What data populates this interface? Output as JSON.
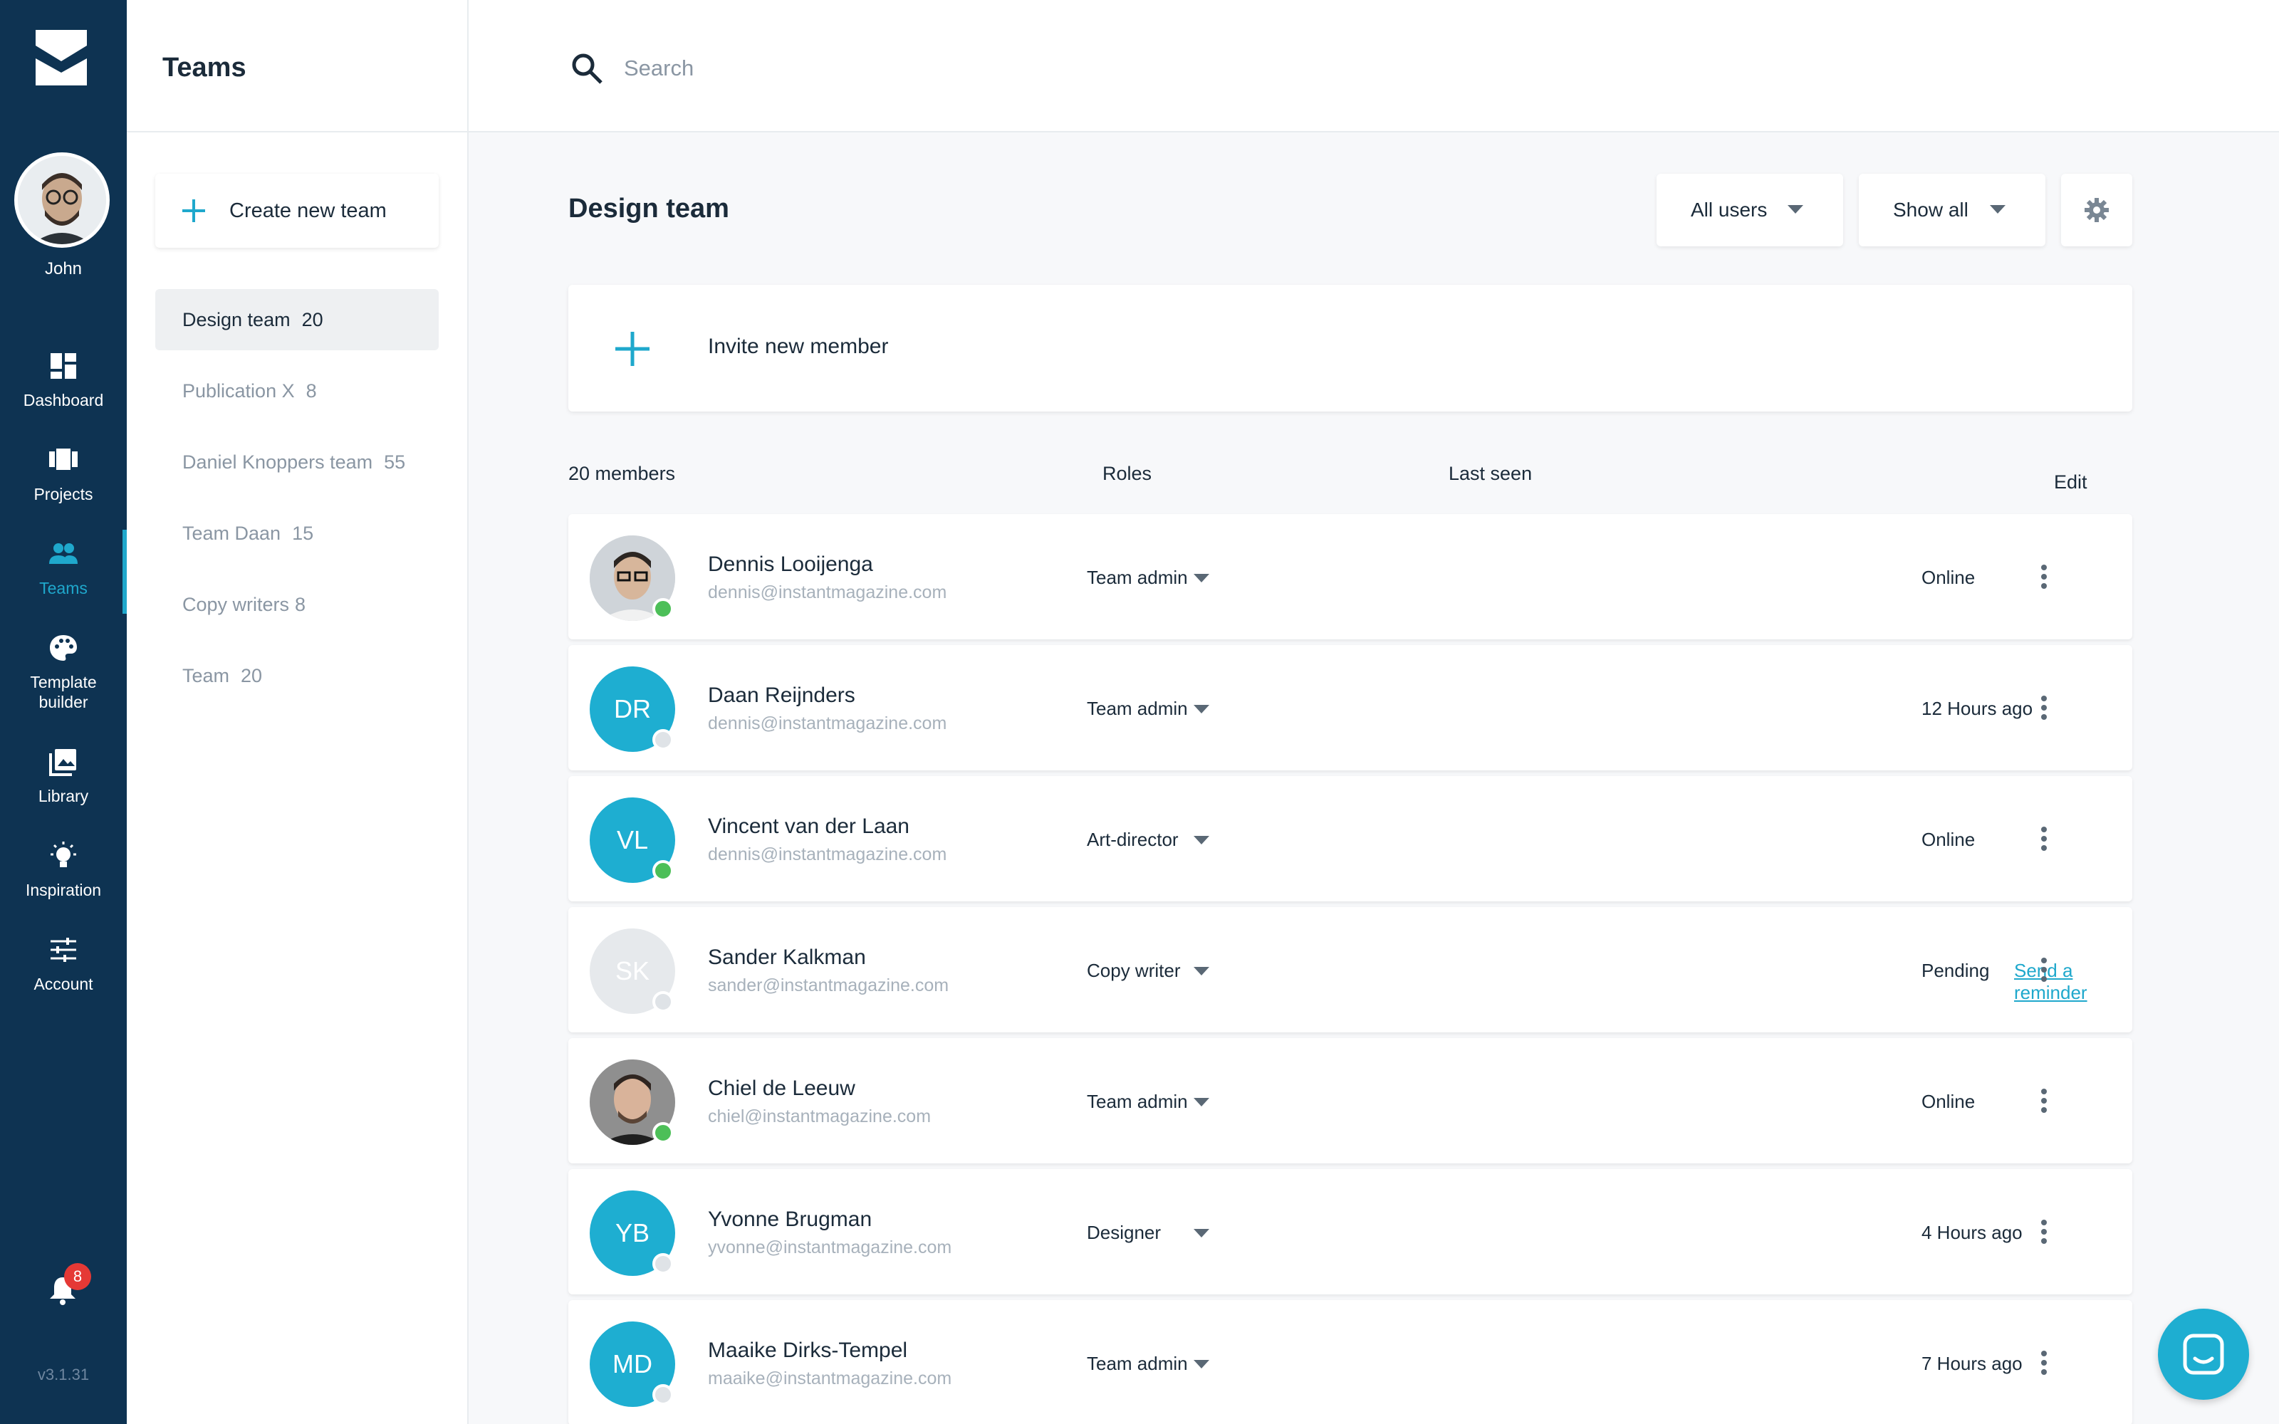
{
  "nav": {
    "username": "John",
    "items": [
      {
        "label": "Dashboard",
        "icon": "dashboard-icon"
      },
      {
        "label": "Projects",
        "icon": "projects-icon"
      },
      {
        "label": "Teams",
        "icon": "teams-icon",
        "active": true
      },
      {
        "label": "Template builder",
        "icon": "palette-icon"
      },
      {
        "label": "Library",
        "icon": "library-icon"
      },
      {
        "label": "Inspiration",
        "icon": "lightbulb-icon"
      },
      {
        "label": "Account",
        "icon": "sliders-icon"
      }
    ],
    "notifications_count": "8",
    "version": "v3.1.31"
  },
  "teams_panel": {
    "title": "Teams",
    "create_label": "Create new team",
    "teams": [
      {
        "name": "Design team",
        "count": "20",
        "active": true
      },
      {
        "name": "Publication X",
        "count": "8"
      },
      {
        "name": "Daniel Knoppers team",
        "count": "55"
      },
      {
        "name": "Team Daan",
        "count": "15"
      },
      {
        "name": "Copy writers",
        "count": "8"
      },
      {
        "name": "Team",
        "count": "20"
      }
    ]
  },
  "search": {
    "placeholder": "Search"
  },
  "main": {
    "title": "Design team",
    "filter_users": "All users",
    "filter_show": "Show all",
    "invite_label": "Invite new member",
    "columns": {
      "members": "20 members",
      "roles": "Roles",
      "last_seen": "Last seen",
      "edit": "Edit"
    }
  },
  "members": [
    {
      "name": "Dennis Looijenga",
      "email": "dennis@instantmagazine.com",
      "role": "Team admin",
      "last_seen": "Online",
      "initials": "",
      "status": "online"
    },
    {
      "name": "Daan Reijnders",
      "email": "dennis@instantmagazine.com",
      "role": "Team admin",
      "last_seen": "12 Hours ago",
      "initials": "DR",
      "status": "offline"
    },
    {
      "name": "Vincent van der Laan",
      "email": "dennis@instantmagazine.com",
      "role": "Art-director",
      "last_seen": "Online",
      "initials": "VL",
      "status": "online"
    },
    {
      "name": "Sander Kalkman",
      "email": "sander@instantmagazine.com",
      "role": "Copy writer",
      "last_seen": "Pending",
      "reminder": "Send a reminder",
      "initials": "SK",
      "status": "pending"
    },
    {
      "name": "Chiel de Leeuw",
      "email": "chiel@instantmagazine.com",
      "role": "Team admin",
      "last_seen": "Online",
      "initials": "",
      "status": "online"
    },
    {
      "name": "Yvonne Brugman",
      "email": "yvonne@instantmagazine.com",
      "role": "Designer",
      "last_seen": "4 Hours ago",
      "initials": "YB",
      "status": "offline"
    },
    {
      "name": "Maaike Dirks-Tempel",
      "email": "maaike@instantmagazine.com",
      "role": "Team admin",
      "last_seen": "7 Hours ago",
      "initials": "MD",
      "status": "offline"
    }
  ],
  "colors": {
    "nav_bg": "#0e3352",
    "accent": "#1fa8cc",
    "online": "#4cbf58",
    "badge": "#e53935"
  }
}
